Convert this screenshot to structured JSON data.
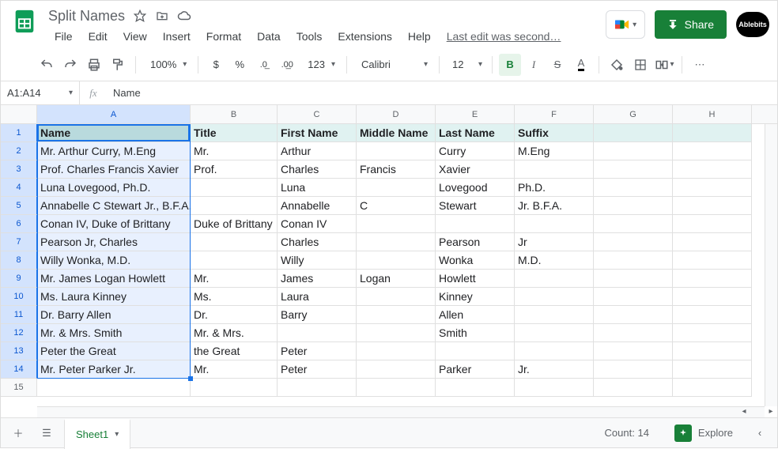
{
  "doc_title": "Split Names",
  "menu": {
    "file": "File",
    "edit": "Edit",
    "view": "View",
    "insert": "Insert",
    "format": "Format",
    "data": "Data",
    "tools": "Tools",
    "extensions": "Extensions",
    "help": "Help",
    "last_edit": "Last edit was second…"
  },
  "share_label": "Share",
  "ablebits_label": "Ablebits",
  "toolbar": {
    "zoom": "100%",
    "dollar": "$",
    "percent": "%",
    "dec_dec": ".0",
    "inc_dec": ".00",
    "num_format": "123",
    "font": "Calibri",
    "font_size": "12",
    "bold": "B",
    "italic": "I",
    "strike": "S",
    "textcolor": "A"
  },
  "namebox": "A1:A14",
  "fx_value": "Name",
  "columns": [
    "A",
    "B",
    "C",
    "D",
    "E",
    "F",
    "G",
    "H"
  ],
  "header_row": [
    "Name",
    "Title",
    "First Name",
    "Middle Name",
    "Last Name",
    "Suffix",
    "",
    ""
  ],
  "rows": [
    [
      "Mr. Arthur Curry, M.Eng",
      "Mr.",
      "Arthur",
      "",
      "Curry",
      "M.Eng",
      "",
      ""
    ],
    [
      "Prof. Charles Francis Xavier",
      "Prof.",
      "Charles",
      "Francis",
      "Xavier",
      "",
      "",
      ""
    ],
    [
      "Luna Lovegood, Ph.D.",
      "",
      "Luna",
      "",
      "Lovegood",
      "Ph.D.",
      "",
      ""
    ],
    [
      "Annabelle C Stewart Jr., B.F.A.",
      "",
      "Annabelle",
      "C",
      "Stewart",
      "Jr. B.F.A.",
      "",
      ""
    ],
    [
      "Conan IV, Duke of Brittany",
      "Duke of Brittany",
      "Conan IV",
      "",
      "",
      "",
      "",
      ""
    ],
    [
      "Pearson Jr, Charles",
      "",
      "Charles",
      "",
      "Pearson",
      "Jr",
      "",
      ""
    ],
    [
      "Willy Wonka, M.D.",
      "",
      "Willy",
      "",
      "Wonka",
      "M.D.",
      "",
      ""
    ],
    [
      "Mr. James Logan Howlett",
      "Mr.",
      "James",
      "Logan",
      "Howlett",
      "",
      "",
      ""
    ],
    [
      "Ms. Laura Kinney",
      "Ms.",
      "Laura",
      "",
      "Kinney",
      "",
      "",
      ""
    ],
    [
      "Dr. Barry Allen",
      "Dr.",
      "Barry",
      "",
      "Allen",
      "",
      "",
      ""
    ],
    [
      "Mr. & Mrs. Smith",
      "Mr. & Mrs.",
      "",
      "",
      "Smith",
      "",
      "",
      ""
    ],
    [
      "Peter the Great",
      "the Great",
      "Peter",
      "",
      "",
      "",
      "",
      ""
    ],
    [
      "Mr. Peter Parker Jr.",
      "Mr.",
      "Peter",
      "",
      "Parker",
      "Jr.",
      "",
      ""
    ]
  ],
  "blank_rows": 1,
  "sheet_tab": "Sheet1",
  "status": {
    "count_label": "Count: 14"
  },
  "explore_label": "Explore"
}
